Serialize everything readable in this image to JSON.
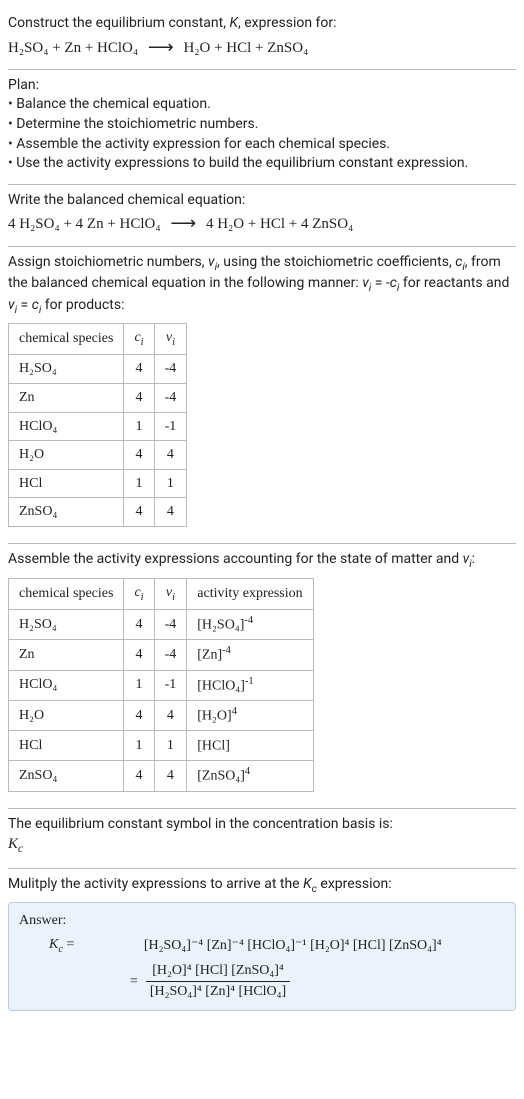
{
  "intro": {
    "construct_line": "Construct the equilibrium constant, K, expression for:",
    "equation_lhs": "H₂SO₄ + Zn + HClO₄",
    "equation_rhs": "H₂O + HCl + ZnSO₄"
  },
  "plan": {
    "heading": "Plan:",
    "items": [
      "• Balance the chemical equation.",
      "• Determine the stoichiometric numbers.",
      "• Assemble the activity expression for each chemical species.",
      "• Use the activity expressions to build the equilibrium constant expression."
    ]
  },
  "balanced": {
    "heading": "Write the balanced chemical equation:",
    "lhs": "4 H₂SO₄ + 4 Zn + HClO₄",
    "rhs": "4 H₂O + HCl + 4 ZnSO₄"
  },
  "stoich": {
    "heading_part1": "Assign stoichiometric numbers, νᵢ, using the stoichiometric coefficients, cᵢ, from the balanced chemical equation in the following manner: νᵢ = -cᵢ for reactants and νᵢ = cᵢ for products:",
    "headers": {
      "species": "chemical species",
      "ci": "cᵢ",
      "vi": "νᵢ"
    },
    "rows": [
      {
        "species": "H₂SO₄",
        "ci": "4",
        "vi": "-4"
      },
      {
        "species": "Zn",
        "ci": "4",
        "vi": "-4"
      },
      {
        "species": "HClO₄",
        "ci": "1",
        "vi": "-1"
      },
      {
        "species": "H₂O",
        "ci": "4",
        "vi": "4"
      },
      {
        "species": "HCl",
        "ci": "1",
        "vi": "1"
      },
      {
        "species": "ZnSO₄",
        "ci": "4",
        "vi": "4"
      }
    ]
  },
  "activity": {
    "heading": "Assemble the activity expressions accounting for the state of matter and νᵢ:",
    "headers": {
      "species": "chemical species",
      "ci": "cᵢ",
      "vi": "νᵢ",
      "act": "activity expression"
    },
    "rows": [
      {
        "species": "H₂SO₄",
        "ci": "4",
        "vi": "-4",
        "act_base": "[H₂SO₄]",
        "act_exp": "-4"
      },
      {
        "species": "Zn",
        "ci": "4",
        "vi": "-4",
        "act_base": "[Zn]",
        "act_exp": "-4"
      },
      {
        "species": "HClO₄",
        "ci": "1",
        "vi": "-1",
        "act_base": "[HClO₄]",
        "act_exp": "-1"
      },
      {
        "species": "H₂O",
        "ci": "4",
        "vi": "4",
        "act_base": "[H₂O]",
        "act_exp": "4"
      },
      {
        "species": "HCl",
        "ci": "1",
        "vi": "1",
        "act_base": "[HCl]",
        "act_exp": ""
      },
      {
        "species": "ZnSO₄",
        "ci": "4",
        "vi": "4",
        "act_base": "[ZnSO₄]",
        "act_exp": "4"
      }
    ]
  },
  "basis": {
    "heading": "The equilibrium constant symbol in the concentration basis is:",
    "symbol": "K꜀"
  },
  "multiply": {
    "heading": "Mulitply the activity expressions to arrive at the K꜀ expression:"
  },
  "answer": {
    "label": "Answer:",
    "kc": "K꜀",
    "line1": "[H₂SO₄]⁻⁴ [Zn]⁻⁴ [HClO₄]⁻¹ [H₂O]⁴ [HCl] [ZnSO₄]⁴",
    "frac_num": "[H₂O]⁴ [HCl] [ZnSO₄]⁴",
    "frac_den": "[H₂SO₄]⁴ [Zn]⁴ [HClO₄]"
  }
}
